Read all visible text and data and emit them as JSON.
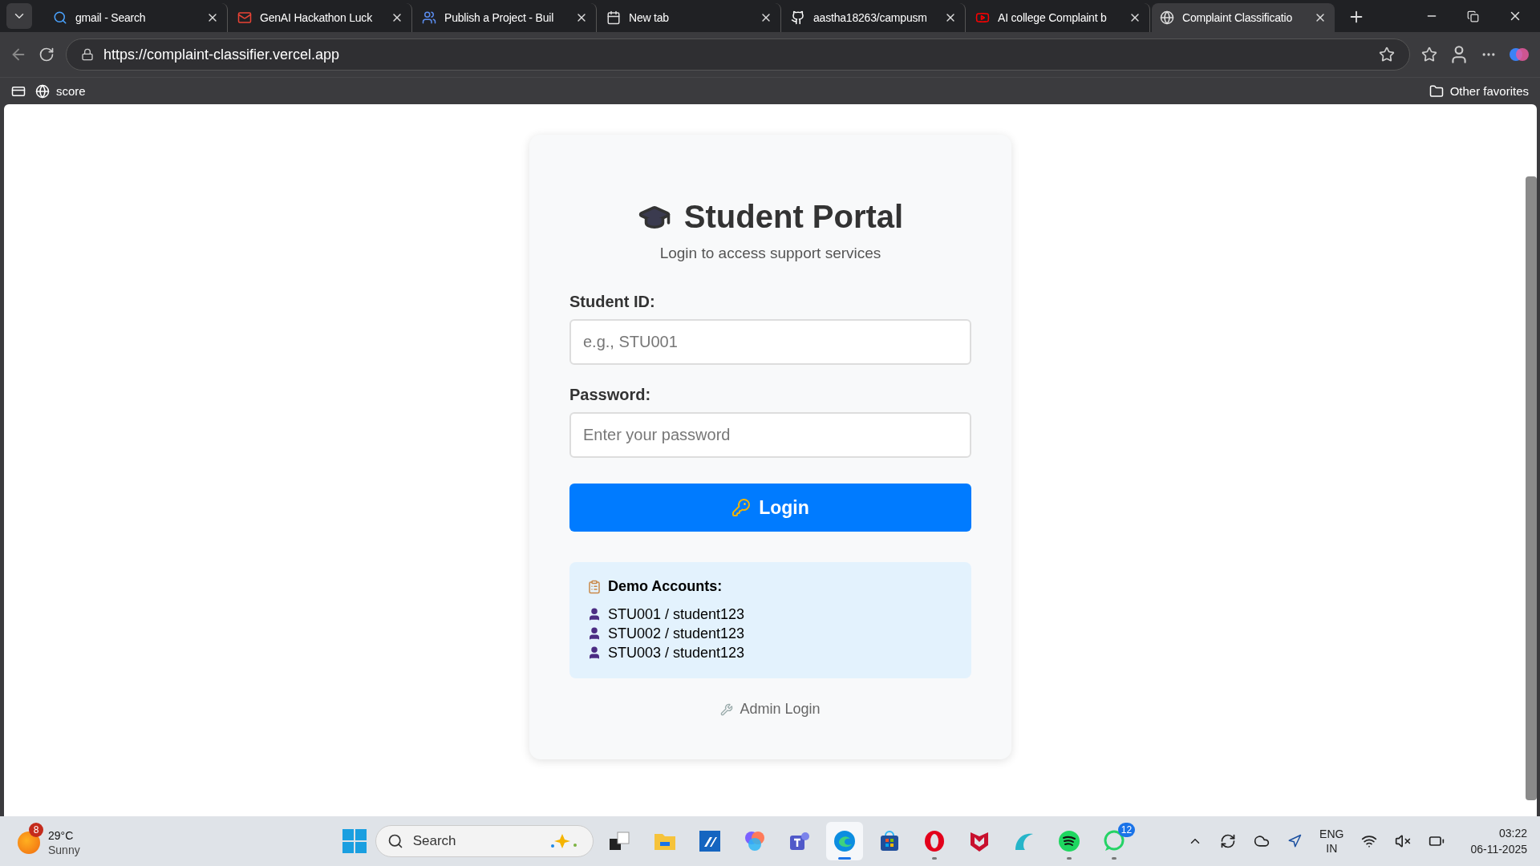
{
  "browser": {
    "tabs": [
      {
        "title": "gmail - Search",
        "selected": false
      },
      {
        "title": "GenAI Hackathon Luck",
        "selected": false
      },
      {
        "title": "Publish a Project - Buil",
        "selected": false
      },
      {
        "title": "New tab",
        "selected": false
      },
      {
        "title": "aastha18263/campusm",
        "selected": false
      },
      {
        "title": "AI college Complaint b",
        "selected": false
      },
      {
        "title": "Complaint Classificatio",
        "selected": true
      }
    ],
    "url": "https://complaint-classifier.vercel.app",
    "bookmarks": [
      {
        "label": "score"
      }
    ],
    "other_favorites": "Other favorites"
  },
  "page": {
    "title": "Student Portal",
    "subtitle": "Login to access support services",
    "fields": [
      {
        "label": "Student ID:",
        "placeholder": "e.g., STU001"
      },
      {
        "label": "Password:",
        "placeholder": "Enter your password"
      }
    ],
    "login_button": "Login",
    "demo": {
      "heading": "Demo Accounts:",
      "accounts": [
        "STU001 / student123",
        "STU002 / student123",
        "STU003 / student123"
      ]
    },
    "admin_link": "Admin Login"
  },
  "taskbar": {
    "weather": {
      "badge": "8",
      "temperature": "29°C",
      "condition": "Sunny"
    },
    "search": "Search",
    "apps": [
      {
        "selected": false,
        "running": false
      },
      {
        "selected": false,
        "running": false
      },
      {
        "selected": false,
        "running": false
      },
      {
        "selected": false,
        "running": false
      },
      {
        "selected": false,
        "running": false
      },
      {
        "selected": true,
        "running": true
      },
      {
        "selected": false,
        "running": false
      },
      {
        "selected": false,
        "running": true
      },
      {
        "selected": false,
        "running": false
      },
      {
        "selected": false,
        "running": false
      },
      {
        "selected": false,
        "running": true
      },
      {
        "selected": false,
        "running": true,
        "badge": "12"
      }
    ],
    "language": [
      "ENG",
      "IN"
    ],
    "time": "03:22",
    "date": "06-11-2025"
  }
}
